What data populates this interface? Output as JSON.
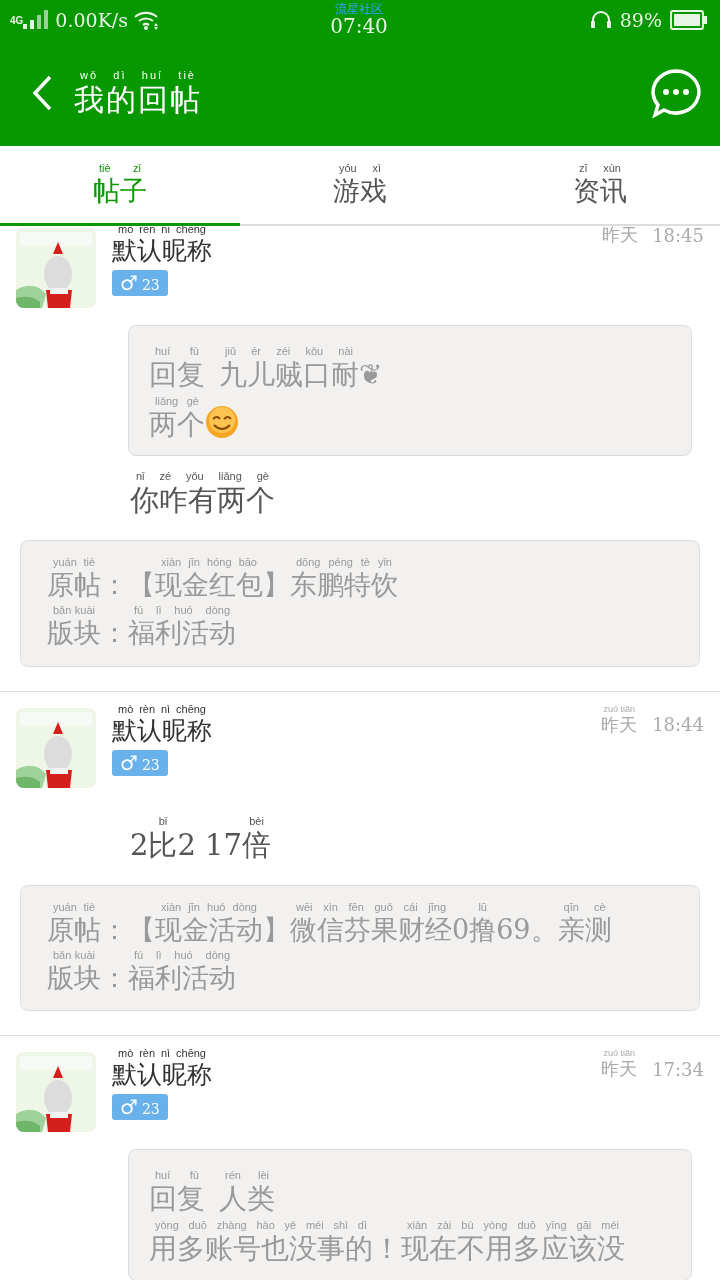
{
  "status_bar": {
    "network": "4G",
    "speed": "0.00K/s",
    "app_name": "流星社区",
    "time": "07:40",
    "battery": "89%"
  },
  "header": {
    "title": [
      {
        "kind": "ruby",
        "text": "我的回帖",
        "pinyin": "wǒ dì huí tiè"
      }
    ]
  },
  "tabs": [
    {
      "label": [
        {
          "kind": "ruby",
          "text": "帖子",
          "pinyin": "tiè zǐ"
        }
      ],
      "selected": true
    },
    {
      "label": [
        {
          "kind": "ruby",
          "text": "游戏",
          "pinyin": "yóu xì"
        }
      ],
      "selected": false
    },
    {
      "label": [
        {
          "kind": "ruby",
          "text": "资讯",
          "pinyin": "zī xùn"
        }
      ],
      "selected": false
    }
  ],
  "posts": [
    {
      "author": [
        {
          "kind": "ruby",
          "text": "默认昵称",
          "pinyin": "mo ren ni cheng"
        }
      ],
      "gender": "♂",
      "age": "23",
      "date": [
        {
          "kind": "plain",
          "text": "昨天"
        }
      ],
      "time": "18:45",
      "quote": [
        [
          {
            "kind": "ruby",
            "text": "回复",
            "pinyin": "huí fù"
          },
          {
            "kind": "ruby",
            "text": "九儿贼口耐",
            "pinyin": "jiǔ ér zéi kǒu nài"
          },
          {
            "kind": "plain",
            "text": "❦"
          }
        ],
        [
          {
            "kind": "ruby",
            "text": "两个",
            "pinyin": "liǎng gè"
          },
          {
            "kind": "smiley"
          }
        ]
      ],
      "reply": [
        [
          {
            "kind": "ruby",
            "text": "你咋有两个",
            "pinyin": "nǐ zé yǒu liǎng gè"
          }
        ]
      ],
      "original": [
        [
          {
            "kind": "ruby",
            "text": "原帖",
            "pinyin": "yuán tiè"
          },
          {
            "kind": "plain",
            "text": "：【"
          },
          {
            "kind": "ruby",
            "text": "现金红包",
            "pinyin": "xiàn jīn hóng bāo"
          },
          {
            "kind": "plain",
            "text": "】"
          },
          {
            "kind": "ruby",
            "text": "东鹏特饮",
            "pinyin": "dōng péng tè yǐn"
          }
        ],
        [
          {
            "kind": "ruby",
            "text": "版块",
            "pinyin": "bǎn kuài"
          },
          {
            "kind": "plain",
            "text": "："
          },
          {
            "kind": "ruby",
            "text": "福利活动",
            "pinyin": "fú lì huó dòng"
          }
        ]
      ]
    },
    {
      "author": [
        {
          "kind": "ruby",
          "text": "默认昵称",
          "pinyin": "mò rèn nì chēng"
        }
      ],
      "gender": "♂",
      "age": "23",
      "date": [
        {
          "kind": "ruby",
          "text": "昨天",
          "pinyin": "zuó tiān"
        }
      ],
      "time": "18:44",
      "reply": [
        [
          {
            "kind": "plain",
            "text": "2"
          },
          {
            "kind": "ruby",
            "text": "比",
            "pinyin": "bǐ"
          },
          {
            "kind": "plain",
            "text": "2 17"
          },
          {
            "kind": "ruby",
            "text": "倍",
            "pinyin": "bèi"
          }
        ]
      ],
      "original": [
        [
          {
            "kind": "ruby",
            "text": "原帖",
            "pinyin": "yuán tiè"
          },
          {
            "kind": "plain",
            "text": "：【"
          },
          {
            "kind": "ruby",
            "text": "现金活动",
            "pinyin": "xiàn jīn huó dòng"
          },
          {
            "kind": "plain",
            "text": "】"
          },
          {
            "kind": "ruby",
            "text": "微信芬果财经",
            "pinyin": "wēi xìn fēn guǒ cái jīng"
          },
          {
            "kind": "plain",
            "text": "0"
          },
          {
            "kind": "ruby",
            "text": "撸",
            "pinyin": "lū"
          },
          {
            "kind": "plain",
            "text": "69。"
          },
          {
            "kind": "ruby",
            "text": "亲测",
            "pinyin": "qīn cè"
          }
        ],
        [
          {
            "kind": "ruby",
            "text": "版块",
            "pinyin": "bǎn kuài"
          },
          {
            "kind": "plain",
            "text": "："
          },
          {
            "kind": "ruby",
            "text": "福利活动",
            "pinyin": "fú lì huó dòng"
          }
        ]
      ]
    },
    {
      "author": [
        {
          "kind": "ruby",
          "text": "默认昵称",
          "pinyin": "mò rèn nì chēng"
        }
      ],
      "gender": "♂",
      "age": "23",
      "date": [
        {
          "kind": "ruby",
          "text": "昨天",
          "pinyin": "zuó tiān"
        }
      ],
      "time": "17:34",
      "quote": [
        [
          {
            "kind": "ruby",
            "text": "回复",
            "pinyin": "huí fù"
          },
          {
            "kind": "ruby",
            "text": "人类",
            "pinyin": "rén lèi"
          }
        ],
        [
          {
            "kind": "ruby",
            "text": "用多账号也没事的",
            "pinyin": "yòng duō zhàng hào yě méi shì dì"
          },
          {
            "kind": "plain",
            "text": "！"
          },
          {
            "kind": "ruby",
            "text": "现在不用多应该没",
            "pinyin": "xiàn zài bù yòng duō yīng gāi méi"
          }
        ]
      ]
    }
  ]
}
